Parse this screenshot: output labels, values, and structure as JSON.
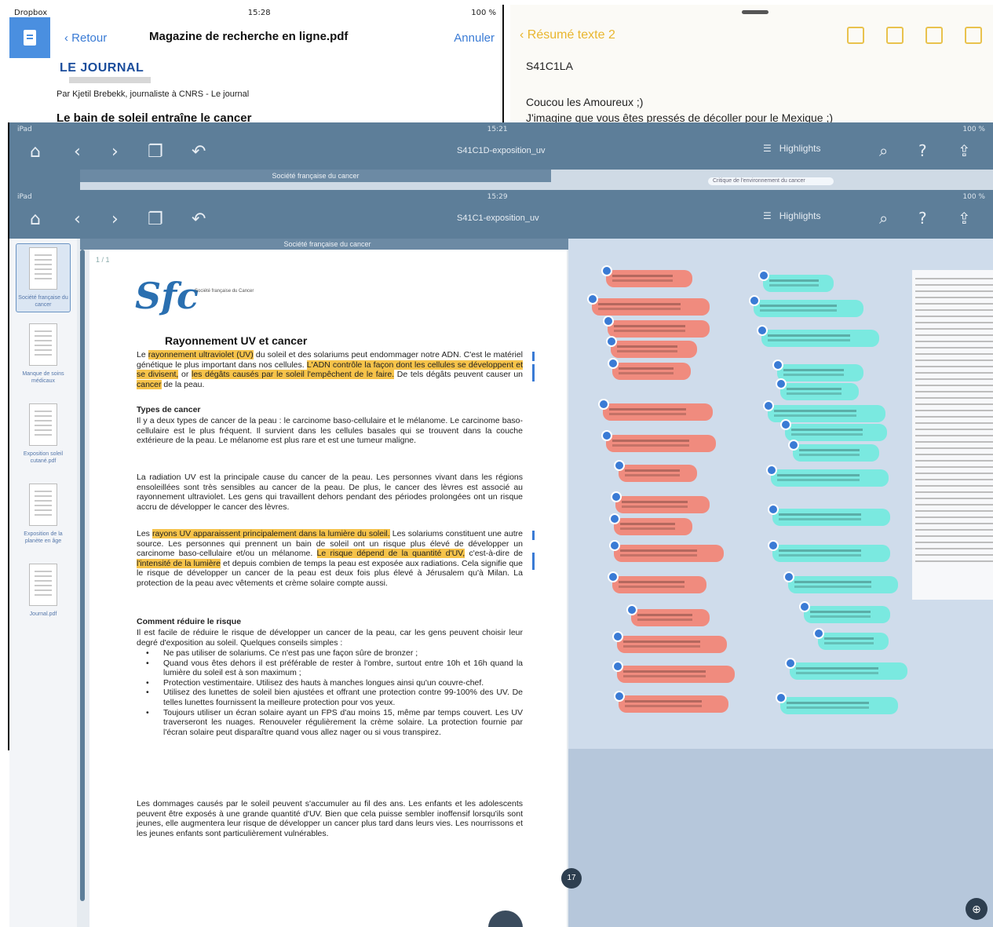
{
  "files_panel": {
    "status": {
      "carrier": "Dropbox",
      "time": "15:28",
      "battery": "100 %"
    },
    "back_label": "Retour",
    "title": "Magazine de recherche en ligne.pdf",
    "cancel_label": "Annuler",
    "journal": "LE JOURNAL",
    "byline": "Par Kjetil Brebekk, journaliste à CNRS - Le journal",
    "headline": "Le bain de soleil entraîne le cancer"
  },
  "notes_panel": {
    "back_label": "Résumé texte 2",
    "code": "S41C1LA",
    "greeting": "Coucou les Amoureux ;)",
    "line": "J'imagine que vous êtes pressés de décoller pour le Mexique ;)"
  },
  "viewer_mid": {
    "status": {
      "device": "iPad",
      "time": "15:21",
      "battery": "100 %"
    },
    "file": "S41C1D-exposition_uv",
    "highlights_label": "Highlights",
    "section": "Société française du cancer",
    "pill": "Critique de l'environnement du cancer"
  },
  "viewer": {
    "status": {
      "device": "iPad",
      "time": "15:29",
      "battery": "100 %"
    },
    "file": "S41C1-exposition_uv",
    "highlights_label": "Highlights",
    "section": "Société française du cancer",
    "page_label": "1 / 1",
    "page_circle": "17",
    "thumbnails": [
      "Société française du cancer",
      "Manque de soins médicaux",
      "Exposition soleil cutané.pdf",
      "Exposition de la planète en âge",
      "Journal.pdf"
    ],
    "logo_sub": "Société française du Cancer"
  },
  "doc": {
    "title": "Rayonnement UV et cancer",
    "p1": [
      "Le ",
      {
        "hl": "rayonnement ultraviolet (UV)"
      },
      " du soleil et des solariums peut endommager notre ADN. C'est le matériel génétique le plus important dans nos cellules. ",
      {
        "hl": "L'ADN contrôle la façon dont les cellules se développent et se divisent,"
      },
      " or ",
      {
        "hl": "les dégâts causés par le soleil l'empêchent de le faire."
      },
      " De tels dégâts peuvent causer un ",
      {
        "hl": "cancer"
      },
      " de la peau."
    ],
    "h_types": "Types de cancer",
    "p2": "Il y a deux types de cancer de la peau : le carcinome baso-cellulaire et le mélanome. Le carcinome baso-cellulaire est le plus fréquent. Il survient dans les cellules basales qui se trouvent dans la couche extérieure de la peau. Le mélanome est plus rare et est une tumeur maligne.",
    "p3": "La radiation UV est la principale cause du cancer de la peau. Les personnes vivant dans les régions ensoleillées sont très sensibles au cancer de la peau. De plus, le cancer des lèvres est associé au rayonnement ultraviolet. Les gens qui travaillent dehors pendant des périodes prolongées ont un risque accru de développer le cancer des lèvres.",
    "p4": [
      "Les ",
      {
        "hl": "rayons UV apparaissent principalement dans la lumière du soleil."
      },
      " Les solariums constituent une autre source. Les personnes qui prennent un bain de soleil ont un risque plus élevé de développer un carcinome baso-cellulaire et/ou un mélanome. ",
      {
        "hl": "Le risque dépend de la quantité d'UV,"
      },
      " c'est-à-dire de ",
      {
        "hl": "l'intensité de la lumière"
      },
      " et depuis combien de temps la peau est exposée aux radiations. Cela signifie que le risque de développer un cancer de la peau est deux fois plus élevé à Jérusalem qu'à Milan. La protection de la peau avec vêtements et crème solaire compte aussi."
    ],
    "h_reduce": "Comment réduire le risque",
    "p5": "Il est facile de réduire le risque de développer un cancer de la peau, car les gens peuvent choisir leur degré d'exposition au soleil. Quelques conseils simples :",
    "bullets": [
      "Ne pas utiliser de solariums. Ce n'est pas une façon sûre de bronzer ;",
      "Quand vous êtes dehors il est préférable de rester à l'ombre, surtout entre 10h et 16h quand la lumière du soleil est à son maximum ;",
      "Protection vestimentaire. Utilisez des hauts à manches longues ainsi qu'un couvre-chef.",
      "Utilisez des lunettes de soleil bien ajustées et offrant une protection contre 99-100% des UV. De telles lunettes fournissent la meilleure protection pour vos yeux.",
      "Toujours utiliser un écran solaire ayant un FPS d'au moins 15, même par temps couvert. Les UV traverseront les nuages. Renouveler régulièrement la crème solaire. La protection fournie par l'écran solaire peut disparaître quand vous allez nager ou si vous transpirez."
    ],
    "p6": "Les dommages causés par le soleil peuvent s'accumuler au fil des ans. Les enfants et les adolescents peuvent être exposés à une grande quantité d'UV. Bien que cela puisse sembler inoffensif lorsqu'ils sont jeunes, elle augmentera leur risque de développer un cancer plus tard dans leurs vies. Les nourrissons et les jeunes enfants sont particulièrement vulnérables."
  },
  "colors": {
    "toolbar": "#5d7e99",
    "highlight": "#f6c34a",
    "bubble_red": "#f08b7e",
    "bubble_cyan": "#7ae9e0",
    "link": "#3a7bd5"
  },
  "icons": [
    "home-icon",
    "chevron-left-icon",
    "chevron-right-icon",
    "pages-icon",
    "undo-icon",
    "list-icon",
    "search-icon",
    "help-icon",
    "share-icon",
    "zoom-icon"
  ]
}
